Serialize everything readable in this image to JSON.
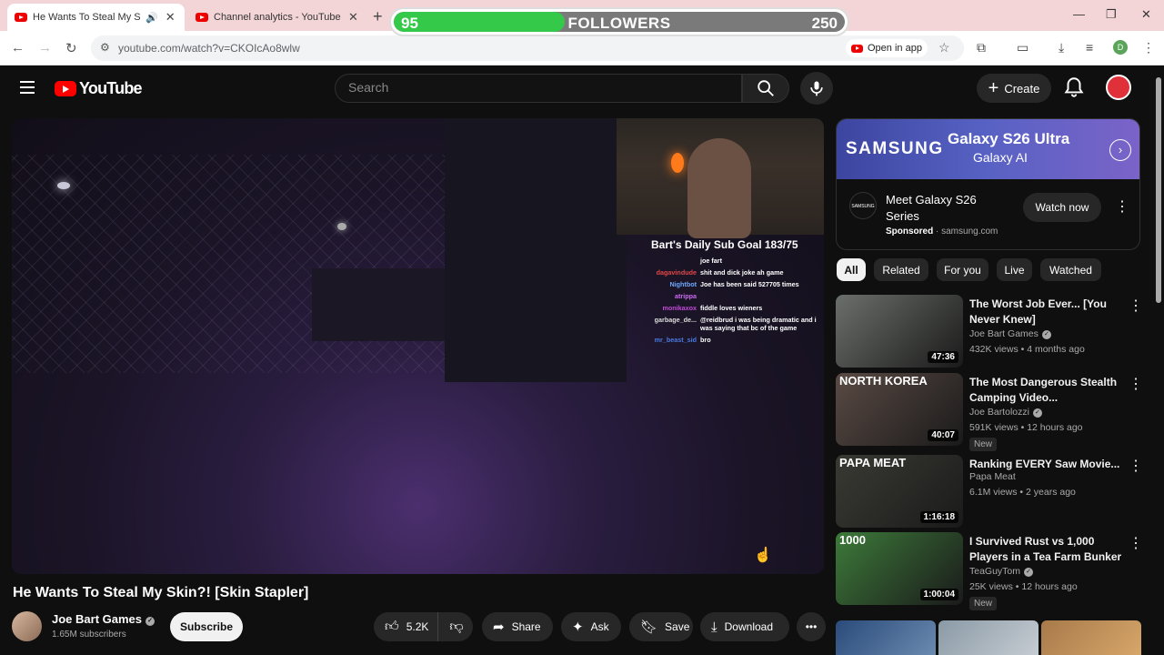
{
  "browser": {
    "tabs": [
      {
        "title": "He Wants To Steal My Skin?!",
        "active": true
      },
      {
        "title": "Channel analytics - YouTube Studio",
        "active": false
      }
    ],
    "url": "youtube.com/watch?v=CKOIcAo8wlw",
    "open_in_app": "Open in app",
    "profile_initial": "D"
  },
  "followers_widget": {
    "current": "95",
    "label": "FOLLOWERS",
    "goal": "250",
    "progress": 0.38
  },
  "header": {
    "logo_text": "YouTube",
    "search_placeholder": "Search",
    "create_label": "Create"
  },
  "stream_overlay": {
    "chat_title": "Bart's Daily Sub Goal 183/75",
    "messages": [
      {
        "user": "",
        "user_color": "#3a6bd6",
        "text": "joe fart"
      },
      {
        "user": "dagavindude",
        "user_color": "#e04848",
        "text": "shit and dick joke ah game"
      },
      {
        "user": "Nightbot",
        "user_color": "#6fa8ff",
        "text": "Joe has been said 527705 times"
      },
      {
        "user": "atrippa",
        "user_color": "#c86bf0",
        "text": ""
      },
      {
        "user": "monikaxox",
        "user_color": "#c04ad8",
        "text": "fiddle loves wieners"
      },
      {
        "user": "garbage_de...",
        "user_color": "#dddddd",
        "text": "@reidbrud i was being dramatic and i was saying that bc of the game"
      },
      {
        "user": "mr_beast_sid",
        "user_color": "#4a7ae0",
        "text": "bro"
      }
    ]
  },
  "video": {
    "title": "He Wants To Steal My Skin?! [Skin Stapler]",
    "channel": "Joe Bart Games",
    "subscribers": "1.65M subscribers",
    "subscribe_label": "Subscribe",
    "likes": "5.2K",
    "share_label": "Share",
    "ask_label": "Ask",
    "save_label": "Save",
    "download_label": "Download"
  },
  "ad": {
    "brand": "SAMSUNG",
    "product": "Galaxy S26 Ultra",
    "subline": "Galaxy AI",
    "title": "Meet Galaxy S26 Series",
    "sponsored": "Sponsored",
    "domain": "samsung.com",
    "logo_text": "SAMSUNG",
    "cta": "Watch now"
  },
  "chips": [
    "All",
    "Related",
    "For you",
    "Live",
    "Watched"
  ],
  "recommendations": [
    {
      "title": "The Worst Job Ever... [You Never Knew]",
      "channel": "Joe Bart Games",
      "verified": true,
      "meta": "432K views • 4 months ago",
      "duration": "47:36",
      "new": "",
      "thumb_label": "",
      "thumb_color": "#6b6f6a"
    },
    {
      "title": "The Most Dangerous Stealth Camping Video...",
      "channel": "Joe Bartolozzi",
      "verified": true,
      "meta": "591K views • 12 hours ago",
      "duration": "40:07",
      "new": "New",
      "thumb_label": "NORTH KOREA",
      "thumb_color": "#5a4a44"
    },
    {
      "title": "Ranking EVERY Saw Movie...",
      "channel": "Papa Meat",
      "verified": false,
      "meta": "6.1M views • 2 years ago",
      "duration": "1:16:18",
      "new": "",
      "thumb_label": "PAPA MEAT",
      "thumb_color": "#3a3a34"
    },
    {
      "title": "I Survived Rust vs 1,000 Players in a Tea Farm Bunker",
      "channel": "TeaGuyTom",
      "verified": true,
      "meta": "25K views • 12 hours ago",
      "duration": "1:00:04",
      "new": "New",
      "thumb_label": "1000",
      "thumb_color": "#3d7a3a"
    }
  ]
}
